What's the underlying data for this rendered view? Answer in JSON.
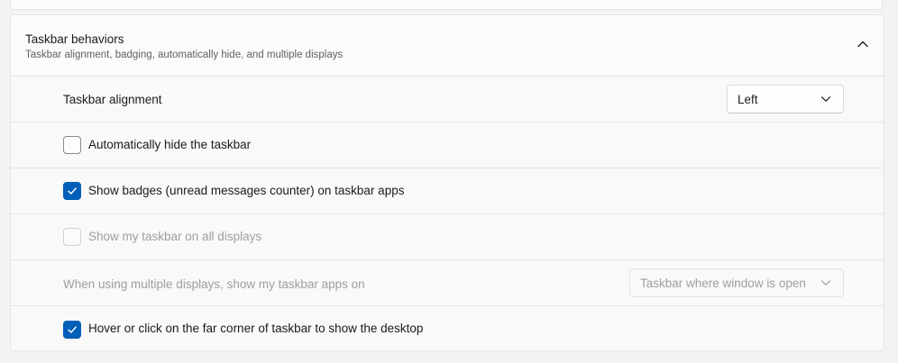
{
  "section": {
    "title": "Taskbar behaviors",
    "subtitle": "Taskbar alignment, badging, automatically hide, and multiple displays",
    "expanded": true
  },
  "alignment": {
    "label": "Taskbar alignment",
    "value": "Left"
  },
  "auto_hide": {
    "label": "Automatically hide the taskbar",
    "checked": false
  },
  "badges": {
    "label": "Show badges (unread messages counter) on taskbar apps",
    "checked": true
  },
  "all_displays": {
    "label": "Show my taskbar on all displays",
    "checked": false,
    "enabled": false
  },
  "multi_display_apps": {
    "label": "When using multiple displays, show my taskbar apps on",
    "value": "Taskbar where window is open",
    "enabled": false
  },
  "show_desktop": {
    "label": "Hover or click on the far corner of taskbar to show the desktop",
    "checked": true
  },
  "colors": {
    "accent": "#005fb8",
    "card_background": "#fbfbfb",
    "page_background": "#f3f3f3",
    "disabled_text": "#9e9e9e"
  },
  "icons": {
    "expander": "chevron-up-icon",
    "dropdown": "chevron-down-icon",
    "check": "checkmark-icon"
  }
}
